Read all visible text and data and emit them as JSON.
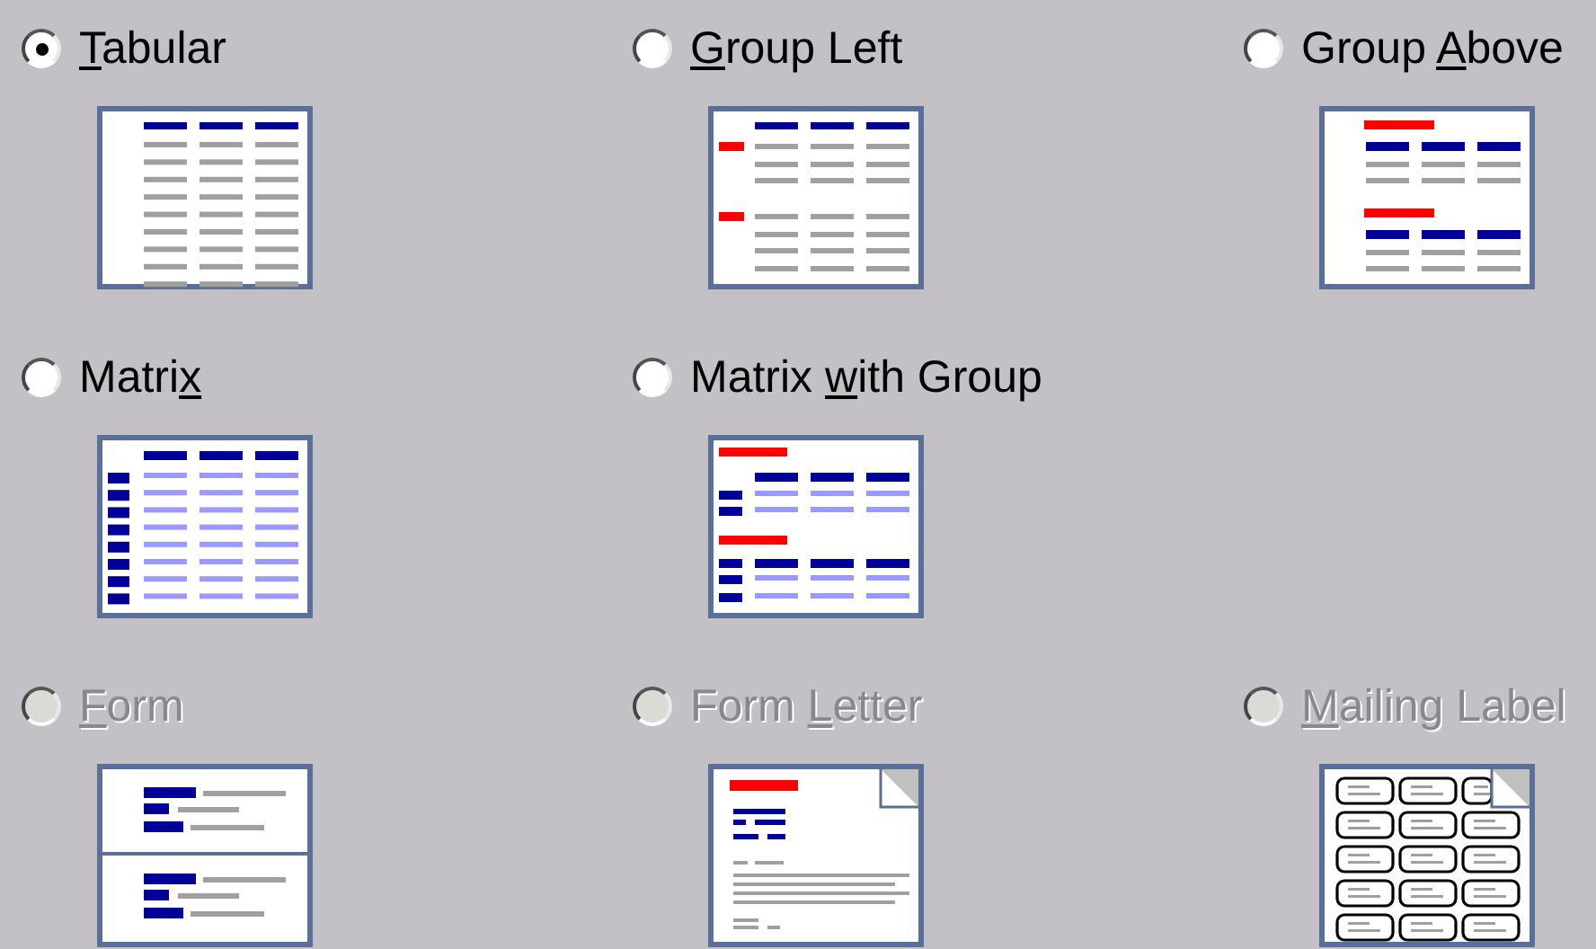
{
  "options": [
    {
      "kind": "tabular",
      "access_key": "T",
      "label_after": "abular",
      "selected": true,
      "disabled": false
    },
    {
      "kind": "group_left",
      "access_key": "G",
      "label_after": "roup Left",
      "selected": false,
      "disabled": false
    },
    {
      "kind": "group_above",
      "label_before": "Group ",
      "access_key": "A",
      "label_after": "bove",
      "selected": false,
      "disabled": false
    },
    {
      "kind": "matrix",
      "label_before": "Matri",
      "access_key": "x",
      "selected": false,
      "disabled": false
    },
    {
      "kind": "matrix_group",
      "label_before": "Matrix ",
      "access_key": "w",
      "label_after": "ith Group",
      "selected": false,
      "disabled": false
    },
    {
      "kind": "form",
      "access_key": "F",
      "label_after": "orm",
      "selected": false,
      "disabled": true
    },
    {
      "kind": "form_letter",
      "label_before": "Form ",
      "access_key": "L",
      "label_after": "etter",
      "selected": false,
      "disabled": true
    },
    {
      "kind": "mailing_label",
      "access_key": "M",
      "label_after": "ailing Label",
      "selected": false,
      "disabled": true
    }
  ]
}
